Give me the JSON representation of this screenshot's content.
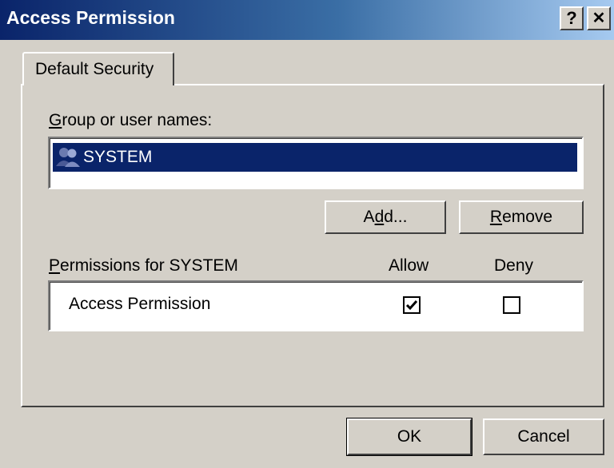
{
  "window": {
    "title": "Access Permission",
    "help_glyph": "?",
    "close_glyph": "✕"
  },
  "tabs": [
    {
      "label": "Default Security"
    }
  ],
  "group_section": {
    "label_accesskey": "G",
    "label_rest": "roup or user names:",
    "users": [
      {
        "name": "SYSTEM",
        "icon": "group-icon",
        "selected": true
      }
    ]
  },
  "buttons": {
    "add": {
      "pre": "A",
      "accesskey": "d",
      "post": "d..."
    },
    "remove": {
      "accesskey": "R",
      "post": "emove"
    },
    "ok": "OK",
    "cancel": "Cancel"
  },
  "permissions": {
    "label_accesskey": "P",
    "label_rest": "ermissions for SYSTEM",
    "col_allow": "Allow",
    "col_deny": "Deny",
    "rows": [
      {
        "name": "Access Permission",
        "allow": true,
        "deny": false
      }
    ]
  },
  "colors": {
    "selection": "#0a246a",
    "face": "#d4d0c8",
    "title_start": "#0a246a",
    "title_end": "#a6caf0"
  }
}
